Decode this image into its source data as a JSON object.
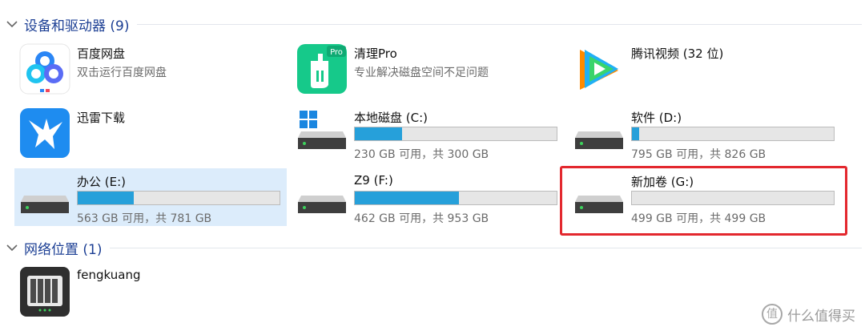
{
  "groups": [
    {
      "title": "设备和驱动器 (9)"
    },
    {
      "title": "网络位置 (1)"
    }
  ],
  "apps": [
    {
      "name": "百度网盘",
      "sub": "双击运行百度网盘",
      "icon": "baidu-netdisk-icon"
    },
    {
      "name": "清理Pro",
      "sub": "专业解决磁盘空间不足问题",
      "icon": "cleaner-pro-icon",
      "badge": "Pro"
    },
    {
      "name": "腾讯视频 (32 位)",
      "sub": "",
      "icon": "tencent-video-icon"
    },
    {
      "name": "迅雷下载",
      "sub": "",
      "icon": "xunlei-icon"
    }
  ],
  "drives": [
    {
      "name": "本地磁盘 (C:)",
      "space": "230 GB 可用，共 300 GB",
      "used_fraction": 0.2333,
      "icon": "system-drive-icon"
    },
    {
      "name": "软件 (D:)",
      "space": "795 GB 可用，共 826 GB",
      "used_fraction": 0.0375,
      "icon": "hard-drive-icon"
    },
    {
      "name": "办公 (E:)",
      "space": "563 GB 可用，共 781 GB",
      "used_fraction": 0.2791,
      "icon": "hard-drive-icon",
      "selected": true
    },
    {
      "name": "Z9 (F:)",
      "space": "462 GB 可用，共 953 GB",
      "used_fraction": 0.5152,
      "icon": "hard-drive-icon"
    },
    {
      "name": "新加卷 (G:)",
      "space": "499 GB 可用，共 499 GB",
      "used_fraction": 0.0,
      "icon": "hard-drive-icon"
    }
  ],
  "network": [
    {
      "name": "fengkuang",
      "icon": "nas-icon"
    }
  ],
  "colors": {
    "accent": "#26a0da",
    "highlight": "#e3282e",
    "selection": "#dcecfb",
    "header": "#1c3f94"
  },
  "watermark": {
    "text": "什么值得买",
    "icon_text": "值"
  }
}
